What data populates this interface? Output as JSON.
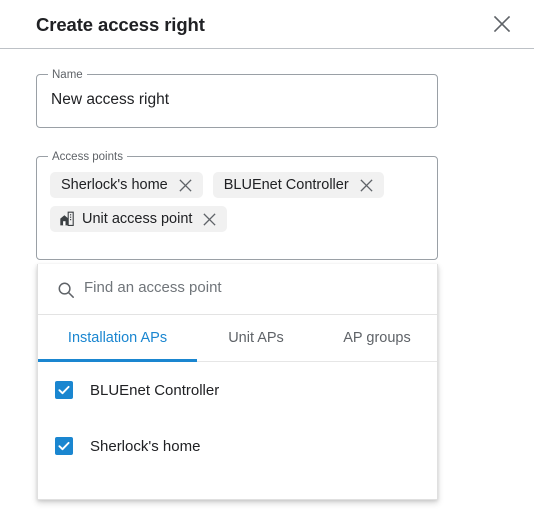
{
  "dialog": {
    "title": "Create access right",
    "close_label": "Close",
    "close_icon": "close-icon"
  },
  "name_field": {
    "legend": "Name",
    "value": "New access right"
  },
  "access_points_field": {
    "legend": "Access points",
    "chips": [
      {
        "label": "Sherlock's home",
        "icon": null,
        "remove_icon": "close-icon"
      },
      {
        "label": "BLUEnet Controller",
        "icon": null,
        "remove_icon": "close-icon"
      },
      {
        "label": "Unit access point",
        "icon": "home-work-icon",
        "remove_icon": "close-icon"
      }
    ]
  },
  "dropdown": {
    "search": {
      "icon": "search-icon",
      "value": "",
      "placeholder": "Find an access point"
    },
    "tabs": [
      {
        "label": "Installation APs",
        "active": true
      },
      {
        "label": "Unit APs",
        "active": false
      },
      {
        "label": "AP groups",
        "active": false
      }
    ],
    "options": [
      {
        "label": "BLUEnet Controller",
        "checked": true
      },
      {
        "label": "Sherlock's home",
        "checked": true
      }
    ]
  },
  "colors": {
    "accent": "#1a86d0",
    "text_primary": "#202124",
    "text_secondary": "#5f6368",
    "chip_background": "#f1f1f1",
    "border": "#9aa0a6"
  }
}
